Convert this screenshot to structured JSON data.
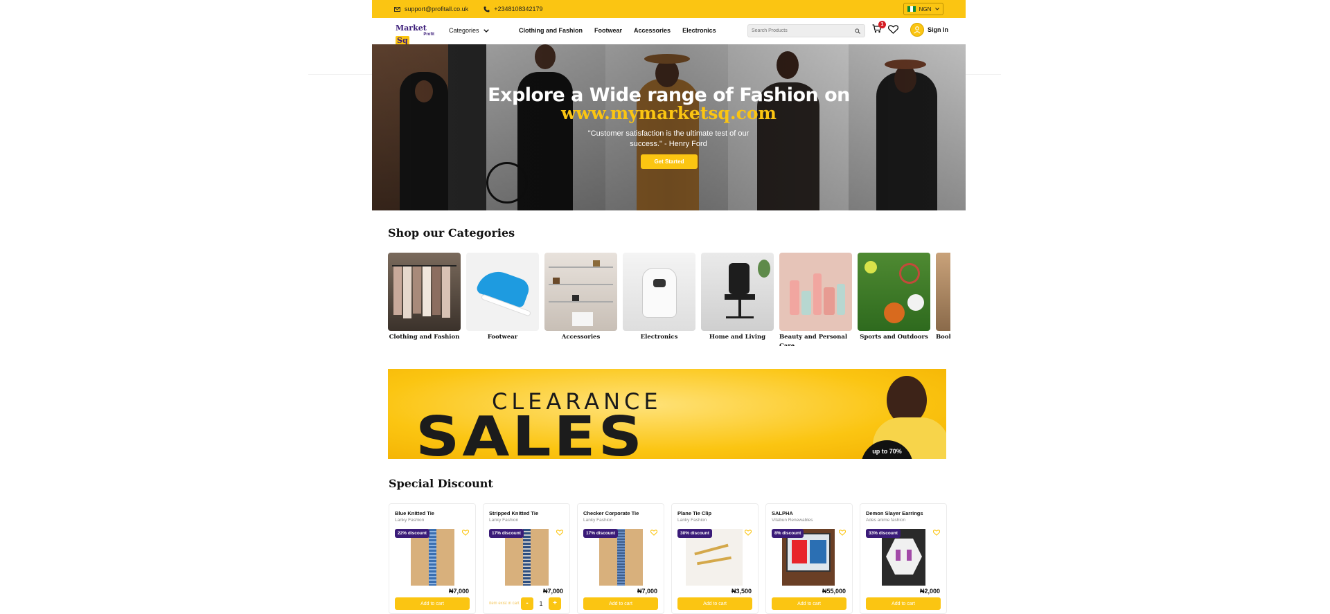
{
  "topbar": {
    "email": "support@profitall.co.uk",
    "phone": "+2348108342179",
    "currency": "NGN"
  },
  "nav": {
    "logo_main": "Market",
    "logo_accent": "Sq",
    "logo_sub": "Profit",
    "categories_label": "Categories",
    "links": [
      "Clothing and Fashion",
      "Footwear",
      "Accessories",
      "Electronics"
    ],
    "search_placeholder": "Search Products",
    "cart_count": "1",
    "signin_label": "Sign In"
  },
  "hero": {
    "title": "Explore a Wide range of Fashion on",
    "url": "www.mymarketsq.com",
    "quote": "\"Customer satisfaction is the ultimate test of our success.\" - Henry Ford",
    "cta": "Get Started"
  },
  "categories": {
    "title": "Shop our Categories",
    "items": [
      "Clothing and Fashion",
      "Footwear",
      "Accessories",
      "Electronics",
      "Home and Living",
      "Beauty and Personal Care",
      "Sports and Outdoors",
      "Books and Media"
    ]
  },
  "banner": {
    "line1": "CLEARANCE",
    "line2": "SALES",
    "badge": "up to 70%"
  },
  "discount": {
    "title": "Special Discount",
    "add_label": "Add to cart",
    "in_cart_label": "Item exist in cart",
    "products": [
      {
        "name": "Blue Knitted Tie",
        "vendor": "Lanky Fashion",
        "discount": "22% discount",
        "price": "₦7,000"
      },
      {
        "name": "Stripped Knitted Tie",
        "vendor": "Lanky Fashion",
        "discount": "17% discount",
        "price": "₦7,000",
        "qty": "1"
      },
      {
        "name": "Checker Corporate Tie",
        "vendor": "Lanky Fashion",
        "discount": "17% discount",
        "price": "₦7,000"
      },
      {
        "name": "Plane Tie Clip",
        "vendor": "Lanky Fashion",
        "discount": "30% discount",
        "price": "₦3,500"
      },
      {
        "name": "SALPHA",
        "vendor": "Vitabun Renewables",
        "discount": "8% discount",
        "price": "₦55,000"
      },
      {
        "name": "Demon Slayer Earrings",
        "vendor": "Ades anime fashion",
        "discount": "33% discount",
        "price": "₦2,000"
      }
    ]
  },
  "colors": {
    "brand_yellow": "#fbc512",
    "brand_purple": "#3a1b78",
    "badge_red": "#d51c24"
  }
}
